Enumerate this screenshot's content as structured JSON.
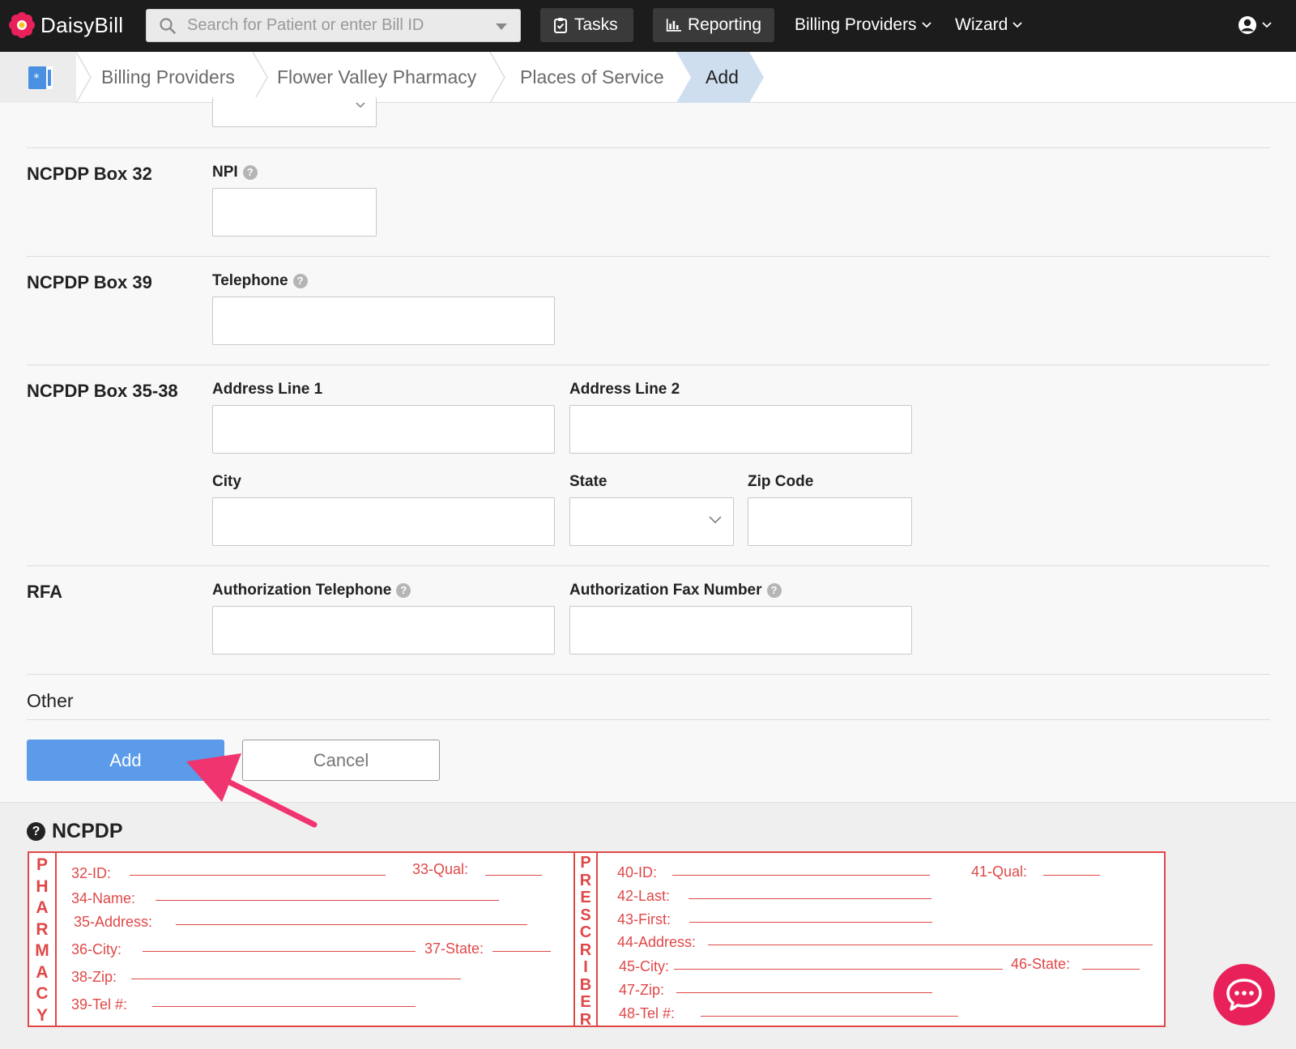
{
  "navbar": {
    "brand": "DaisyBill",
    "search_placeholder": "Search for Patient or enter Bill ID",
    "tasks_label": "Tasks",
    "reporting_label": "Reporting",
    "billing_providers_label": "Billing Providers",
    "wizard_label": "Wizard"
  },
  "breadcrumb": {
    "items": [
      "Billing Providers",
      "Flower Valley Pharmacy",
      "Places of Service"
    ],
    "current": "Add"
  },
  "form": {
    "box32": {
      "title": "NCPDP Box 32",
      "npi_label": "NPI"
    },
    "box39": {
      "title": "NCPDP Box 39",
      "telephone_label": "Telephone"
    },
    "box35_38": {
      "title": "NCPDP Box 35-38",
      "address1_label": "Address Line 1",
      "address2_label": "Address Line 2",
      "city_label": "City",
      "state_label": "State",
      "zip_label": "Zip Code"
    },
    "rfa": {
      "title": "RFA",
      "auth_tel_label": "Authorization Telephone",
      "auth_fax_label": "Authorization Fax Number"
    },
    "other_title": "Other",
    "add_button": "Add",
    "cancel_button": "Cancel"
  },
  "ncpdp": {
    "title": "NCPDP",
    "pharmacy_letters": [
      "P",
      "H",
      "A",
      "R",
      "M",
      "A",
      "C",
      "Y"
    ],
    "prescriber_letters": [
      "P",
      "R",
      "E",
      "S",
      "C",
      "R",
      "I",
      "B",
      "E",
      "R"
    ],
    "pharmacy_fields": {
      "id": "32-ID:",
      "qual": "33-Qual:",
      "name": "34-Name:",
      "address": "35-Address:",
      "city": "36-City:",
      "state": "37-State:",
      "zip": "38-Zip:",
      "tel": "39-Tel #:"
    },
    "prescriber_fields": {
      "id": "40-ID:",
      "qual": "41-Qual:",
      "last": "42-Last:",
      "first": "43-First:",
      "address": "44-Address:",
      "city": "45-City:",
      "state": "46-State:",
      "zip": "47-Zip:",
      "tel": "48-Tel #:"
    }
  },
  "colors": {
    "navbar_bg": "#1c1c1c",
    "primary_button": "#5b9bea",
    "form_red": "#e04848",
    "annotation_arrow": "#f0346f",
    "chat_button": "#e8215a"
  }
}
